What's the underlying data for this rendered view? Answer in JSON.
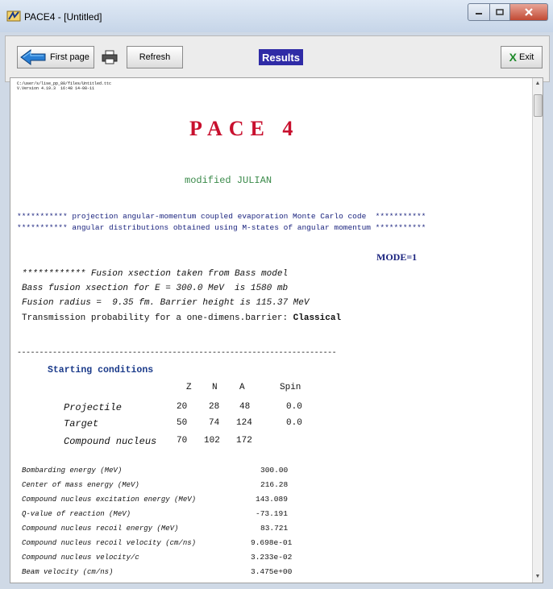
{
  "window": {
    "title": "PACE4 - [Untitled]"
  },
  "toolbar": {
    "first_page_label": "First page",
    "refresh_label": "Refresh",
    "results_label": "Results",
    "exit_label": "Exit",
    "exit_icon": "X"
  },
  "document": {
    "path_line1": "C:/user/s/lise_pp_88/files/Untitled.ttc",
    "path_line2": "V.Version 4.19.3  16:48 14-08-11",
    "title": "PACE 4",
    "subtitle": "modified JULIAN",
    "banner_line1": "*********** projection angular-momentum coupled evaporation Monte Carlo code  ***********",
    "banner_line2": "*********** angular distributions obtained using M-states of angular momentum ***********",
    "mode": "MODE=1",
    "fusion_lines": [
      "************ Fusion xsection taken from Bass model",
      "Bass fusion xsection for E = 300.0 MeV  is 1580 mb",
      "Fusion radius =  9.35 fm. Barrier height is 115.37 MeV"
    ],
    "transmission_prefix": "Transmission probability for a one-dimens.barrier: ",
    "transmission_value": "Classical",
    "separator": "------------------------------------------------------------------------",
    "starting_conditions": {
      "heading": "Starting conditions",
      "headers": [
        "Z",
        "N",
        "A",
        "Spin"
      ],
      "rows": [
        {
          "label": "Projectile",
          "z": "20",
          "n": "28",
          "a": "48",
          "spin": "0.0"
        },
        {
          "label": "Target",
          "z": "50",
          "n": "74",
          "a": "124",
          "spin": "0.0"
        },
        {
          "label": "Compound nucleus",
          "z": "70",
          "n": "102",
          "a": "172",
          "spin": ""
        }
      ]
    },
    "results_rows": [
      {
        "label": "Bombarding energy (MeV)",
        "value": "300.00"
      },
      {
        "label": "Center of mass energy (MeV)",
        "value": "216.28"
      },
      {
        "label": "Compound nucleus excitation energy (MeV)",
        "value": "143.089"
      },
      {
        "label": "Q-value of reaction (MeV)",
        "value": "-73.191"
      },
      {
        "label": "Compound nucleus recoil energy (MeV)",
        "value": "83.721"
      },
      {
        "label": "Compound nucleus recoil velocity (cm/ns)",
        "value": "9.698e-01"
      },
      {
        "label": "Compound nucleus velocity/c",
        "value": "3.233e-02"
      },
      {
        "label": "Beam velocity (cm/ns)",
        "value": "3.475e+00"
      }
    ]
  },
  "colors": {
    "title_red": "#c8102e",
    "julian_green": "#3a8a4a",
    "banner_blue": "#1a237e",
    "results_bg": "#2f2ba6",
    "close_red": "#c24a34"
  }
}
